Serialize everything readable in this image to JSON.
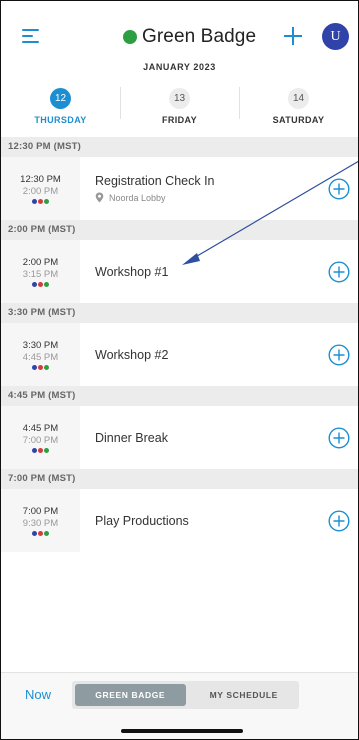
{
  "header": {
    "title": "Green Badge",
    "avatar_initial": "U",
    "accent_color": "#1d8fd0",
    "badge_color": "#2d9e44"
  },
  "month": "JANUARY 2023",
  "days": [
    {
      "num": "12",
      "name": "THURSDAY",
      "active": true
    },
    {
      "num": "13",
      "name": "FRIDAY",
      "active": false
    },
    {
      "num": "14",
      "name": "SATURDAY",
      "active": false
    }
  ],
  "schedule": [
    {
      "header": "12:30 PM (MST)",
      "start": "12:30 PM",
      "end": "2:00 PM",
      "title": "Registration Check In",
      "location": "Noorda Lobby"
    },
    {
      "header": "2:00 PM (MST)",
      "start": "2:00 PM",
      "end": "3:15 PM",
      "title": "Workshop #1",
      "location": ""
    },
    {
      "header": "3:30 PM (MST)",
      "start": "3:30 PM",
      "end": "4:45 PM",
      "title": "Workshop #2",
      "location": ""
    },
    {
      "header": "4:45 PM (MST)",
      "start": "4:45 PM",
      "end": "7:00 PM",
      "title": "Dinner Break",
      "location": ""
    },
    {
      "header": "7:00 PM (MST)",
      "start": "7:00 PM",
      "end": "9:30 PM",
      "title": "Play Productions",
      "location": ""
    }
  ],
  "dot_colors": [
    "#2f43a8",
    "#d63b3b",
    "#2d9e44"
  ],
  "bottom": {
    "now_label": "Now",
    "tabs": [
      {
        "label": "GREEN BADGE",
        "active": true
      },
      {
        "label": "MY SCHEDULE",
        "active": false
      }
    ]
  }
}
